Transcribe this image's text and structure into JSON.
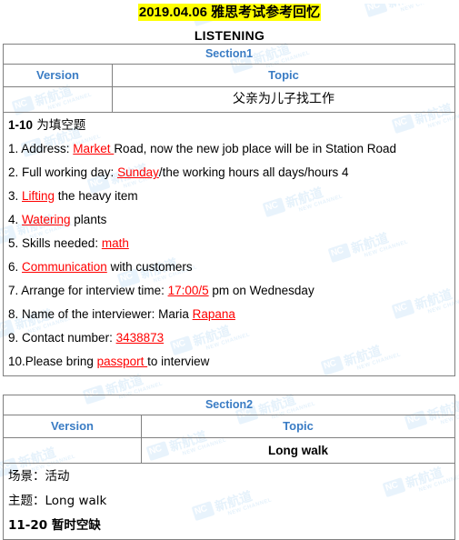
{
  "document": {
    "title": "2019.04.06 雅思考试参考回忆",
    "subtitle": "LISTENING",
    "highlight_color": "#ffff00",
    "header_color": "#3a7cc4",
    "answer_color": "#ff0000"
  },
  "watermark": {
    "logo_text": "NC",
    "cn_text": "新航道",
    "en_text": "NEW CHANNEL",
    "color": "#e6f2fb"
  },
  "section1": {
    "section_label": "Section1",
    "col_version": "Version",
    "col_topic": "Topic",
    "version_value": "",
    "topic_value": "父亲为儿子找工作",
    "intro_bold": "1-10",
    "intro_rest": " 为填空题",
    "questions": [
      {
        "num": "1. ",
        "pre": "Address: ",
        "answer": "Market ",
        "post": "Road, now the new job place will be in Station Road"
      },
      {
        "num": "2. ",
        "pre": "Full working day: ",
        "answer": "Sunday",
        "post": "/the working hours all days/hours 4"
      },
      {
        "num": "3. ",
        "pre": "",
        "answer": "Lifting",
        "post": " the heavy item"
      },
      {
        "num": "4. ",
        "pre": "",
        "answer": "Watering",
        "post": " plants"
      },
      {
        "num": "5. ",
        "pre": "Skills needed: ",
        "answer": "math",
        "post": ""
      },
      {
        "num": "6. ",
        "pre": "",
        "answer": "Communication",
        "post": " with customers"
      },
      {
        "num": "7. ",
        "pre": "Arrange for interview time: ",
        "answer": "17:00/5",
        "post": " pm on Wednesday"
      },
      {
        "num": "8. ",
        "pre": "Name of the interviewer: Maria ",
        "answer": "Rapana",
        "post": ""
      },
      {
        "num": "9. ",
        "pre": "Contact number: ",
        "answer": "3438873",
        "post": ""
      },
      {
        "num": "10.",
        "pre": "Please bring ",
        "answer": "passport ",
        "post": "to interview"
      }
    ]
  },
  "section2": {
    "section_label": "Section2",
    "col_version": "Version",
    "col_topic": "Topic",
    "version_value": "",
    "topic_value": "Long walk",
    "scene_label": "场景：",
    "scene_value": "活动",
    "theme_label": "主题：",
    "theme_value": "Long walk",
    "status_bold": "11-20",
    "status_rest": "  暂时空缺"
  }
}
